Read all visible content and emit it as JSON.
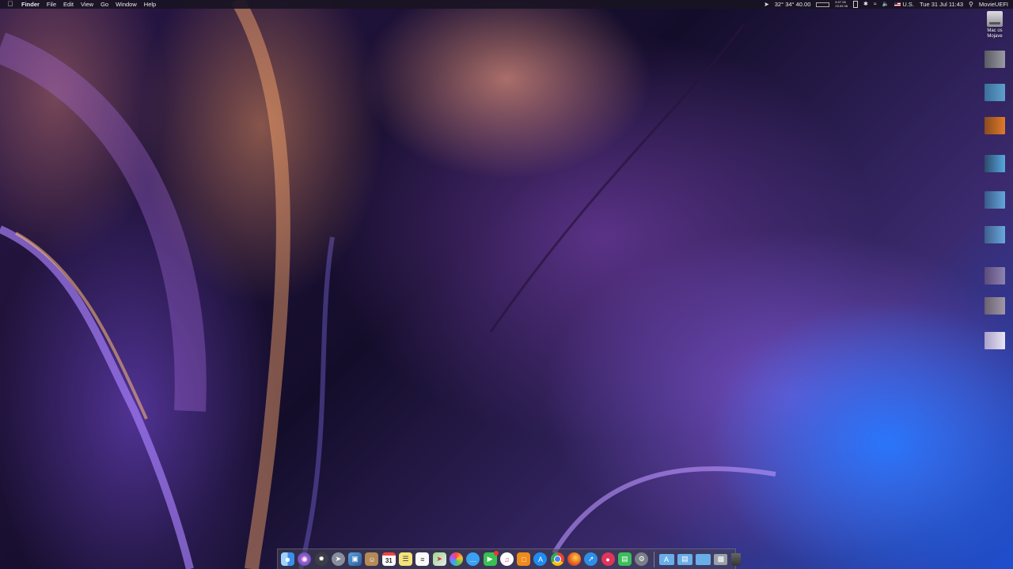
{
  "menubar": {
    "apple_icon": "apple-icon",
    "app": "Finder",
    "menus": [
      "File",
      "Edit",
      "View",
      "Go",
      "Window",
      "Help"
    ],
    "status": {
      "temps": "32° 34° 40.00",
      "net_line1": "8.07 08",
      "net_line2": "23.93 08",
      "input_source": "U.S.",
      "clock": "Tue 31 Jul 11:43",
      "user": "MovieUEFI"
    }
  },
  "desktop": {
    "drive_label_1": "Mac os",
    "drive_label_2": "Mojave"
  },
  "dock": {
    "apps": [
      "Finder",
      "Siri",
      "Launchpad",
      "Safari-compass",
      "Preview",
      "Contacts",
      "Calendar",
      "Notes",
      "Reminders",
      "Maps",
      "Photos",
      "Messages",
      "FaceTime",
      "iTunes",
      "iBooks",
      "App Store",
      "Chrome",
      "Firefox",
      "Safari",
      "Lipstick app",
      "Numbers",
      "System Preferences"
    ],
    "calendar_day": "31",
    "folders": [
      "Applications",
      "Documents",
      "Downloads",
      "Downloads stack"
    ],
    "trash": "Trash"
  }
}
